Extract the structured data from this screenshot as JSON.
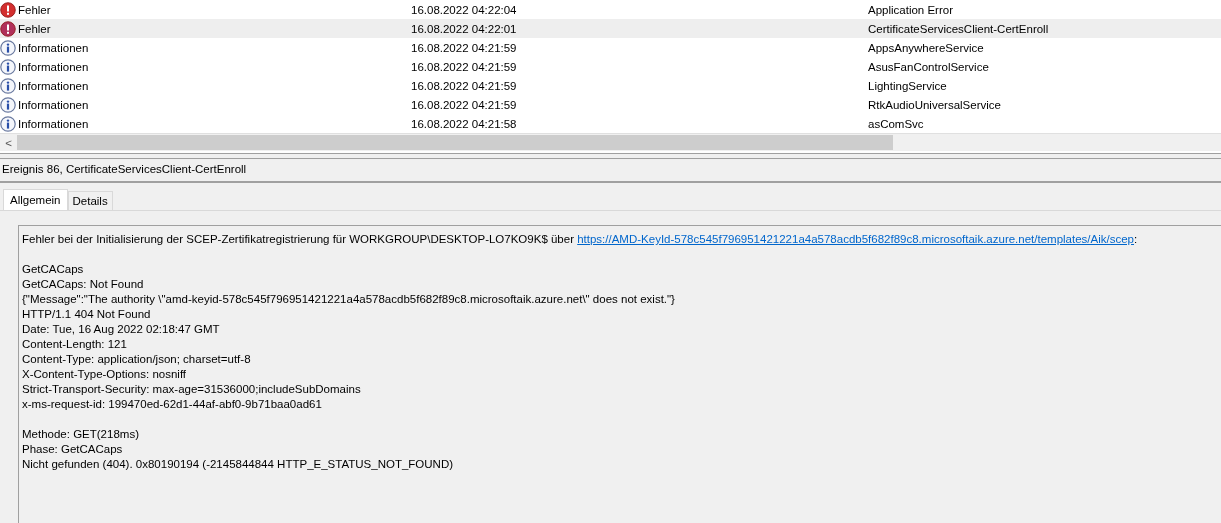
{
  "events": [
    {
      "kind": "error",
      "level": "Fehler",
      "date": "16.08.2022 04:22:04",
      "source": "Application Error",
      "selected": false
    },
    {
      "kind": "error",
      "level": "Fehler",
      "date": "16.08.2022 04:22:01",
      "source": "CertificateServicesClient-CertEnroll",
      "selected": true
    },
    {
      "kind": "info",
      "level": "Informationen",
      "date": "16.08.2022 04:21:59",
      "source": "AppsAnywhereService",
      "selected": false
    },
    {
      "kind": "info",
      "level": "Informationen",
      "date": "16.08.2022 04:21:59",
      "source": "AsusFanControlService",
      "selected": false
    },
    {
      "kind": "info",
      "level": "Informationen",
      "date": "16.08.2022 04:21:59",
      "source": "LightingService",
      "selected": false
    },
    {
      "kind": "info",
      "level": "Informationen",
      "date": "16.08.2022 04:21:59",
      "source": "RtkAudioUniversalService",
      "selected": false
    },
    {
      "kind": "info",
      "level": "Informationen",
      "date": "16.08.2022 04:21:58",
      "source": "asComSvc",
      "selected": false
    }
  ],
  "scroll_left": "<",
  "detail": {
    "title": "Ereignis 86, CertificateServicesClient-CertEnroll",
    "tabs": [
      {
        "label": "Allgemein",
        "selected": true
      },
      {
        "label": "Details",
        "selected": false
      }
    ],
    "intro": {
      "text": "Fehler bei der Initialisierung der SCEP-Zertifikatregistrierung für WORKGROUP\\DESKTOP-LO7KO9K$ über",
      "link": "https://AMD-KeyId-578c545f796951421221a4a578acdb5f682f89c8.microsoftaik.azure.net/templates/Aik/scep",
      "after": ":"
    },
    "paragraphs": [
      [
        "GetCACaps",
        "GetCACaps: Not Found",
        "{\"Message\":\"The authority \\\"amd-keyid-578c545f796951421221a4a578acdb5f682f89c8.microsoftaik.azure.net\\\" does not exist.\"}",
        "HTTP/1.1 404 Not Found",
        "Date: Tue, 16 Aug 2022 02:18:47 GMT",
        "Content-Length: 121",
        "Content-Type: application/json; charset=utf-8",
        "X-Content-Type-Options: nosniff",
        "Strict-Transport-Security: max-age=31536000;includeSubDomains",
        "x-ms-request-id: 199470ed-62d1-44af-abf0-9b71baa0ad61"
      ],
      [
        "Methode: GET(218ms)",
        "Phase: GetCACaps",
        "Nicht gefunden (404). 0x80190194 (-2145844844 HTTP_E_STATUS_NOT_FOUND)"
      ]
    ]
  }
}
